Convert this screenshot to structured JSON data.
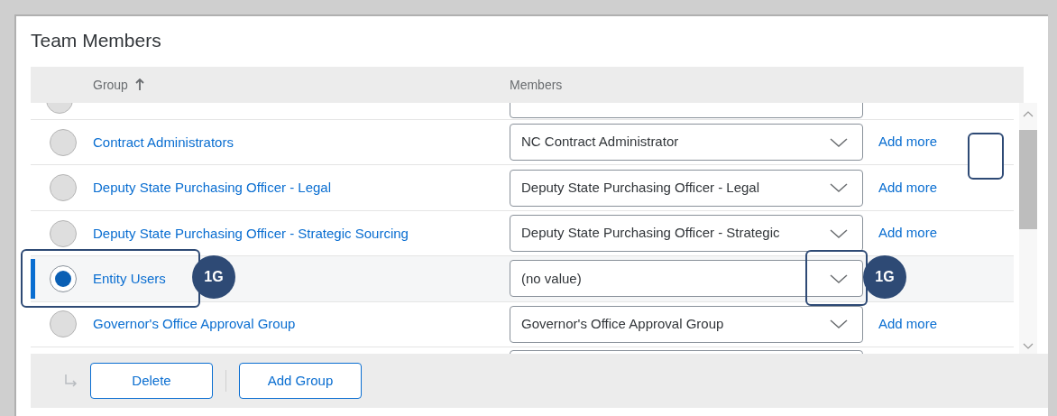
{
  "section": {
    "title": "Team Members"
  },
  "table": {
    "columns": [
      {
        "label": "Group",
        "sorted": true
      },
      {
        "label": "Members"
      }
    ],
    "clipped_row_above": {
      "selected": false
    },
    "rows": [
      {
        "group": "Contract Administrators",
        "members": "NC Contract Administrator",
        "selected": false,
        "action": "Add more"
      },
      {
        "group": "Deputy State Purchasing Officer - Legal",
        "members": "Deputy State Purchasing Officer - Legal",
        "selected": false,
        "action": "Add more"
      },
      {
        "group": "Deputy State Purchasing Officer - Strategic Sourcing",
        "members": "Deputy State Purchasing Officer - Strategic",
        "selected": false,
        "action": "Add more"
      },
      {
        "group": "Entity Users",
        "members": "(no value)",
        "selected": true
      },
      {
        "group": "Governor's Office Approval Group",
        "members": "Governor's Office Approval Group",
        "selected": false,
        "action": "Add more"
      }
    ]
  },
  "footer": {
    "buttons": [
      "Delete",
      "Add Group"
    ]
  },
  "callouts": [
    {
      "label": "1G"
    },
    {
      "label": "1G"
    }
  ]
}
